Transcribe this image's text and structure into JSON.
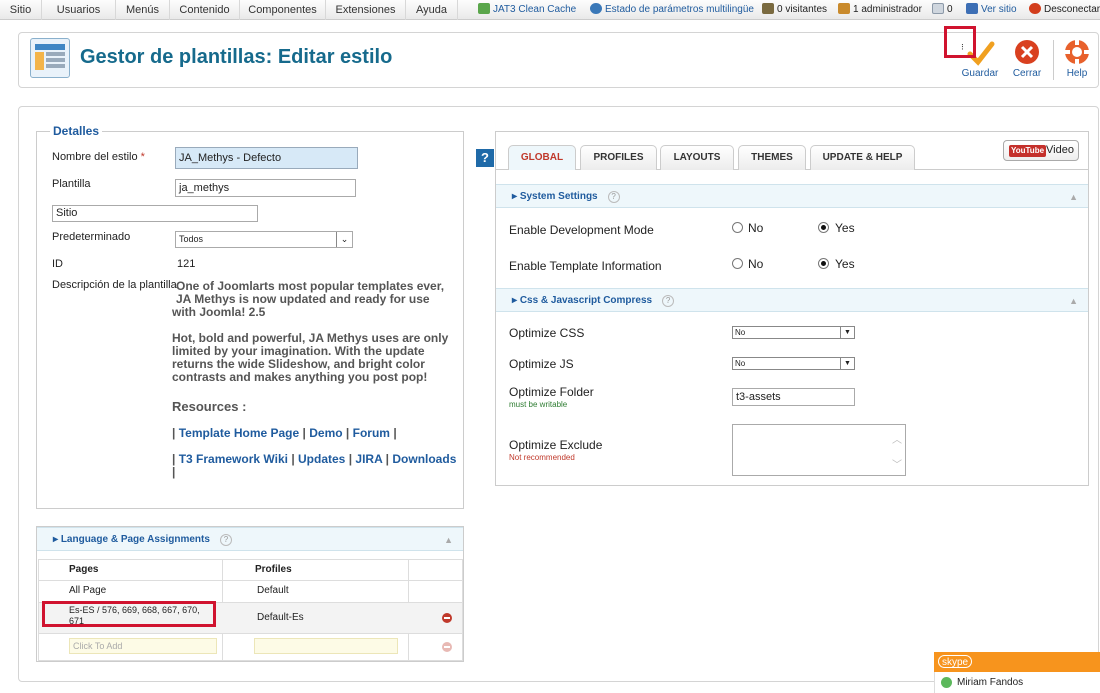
{
  "top_menu": [
    "Sitio",
    "Usuarios",
    "Menús",
    "Contenido",
    "Componentes",
    "Extensiones",
    "Ayuda"
  ],
  "status": {
    "jat3": "JAT3 Clean Cache",
    "multilang": "Estado de parámetros multilingüe",
    "visitors": "0 visitantes",
    "admins": "1 administrador",
    "messages": "0",
    "view_site": "Ver sitio",
    "logout": "Desconectar"
  },
  "header": {
    "title": "Gestor de plantillas: Editar estilo",
    "save": "Guardar",
    "close": "Cerrar",
    "help": "Help"
  },
  "details": {
    "legend": "Detalles",
    "style_name_label": "Nombre del estilo",
    "required_mark": "*",
    "style_name_value": "JA_Methys - Defecto",
    "template_label": "Plantilla",
    "template_value": "ja_methys",
    "site_value": "Sitio",
    "default_label": "Predeterminado",
    "default_value": "Todos",
    "id_label": "ID",
    "id_value": "121",
    "desc_label": "Descripción de la plantilla",
    "desc_p1_l1": "One of Joomlarts most popular templates ever,",
    "desc_p1_l2": "JA Methys is now updated and ready for use",
    "desc_p1_l3": "with Joomla! 2.5",
    "desc_p2_l1": "Hot, bold and powerful, JA Methys uses are only",
    "desc_p2_l2": "limited by your imagination. With the update",
    "desc_p2_l3": "returns the wide Slideshow, and bright color",
    "desc_p2_l4": "contrasts and makes anything you post pop!",
    "resources": "Resources :",
    "links1": [
      "Template Home Page",
      "Demo",
      "Forum"
    ],
    "links2": [
      "T3 Framework Wiki",
      "Updates",
      "JIRA",
      "Downloads"
    ],
    "sep": "|"
  },
  "tabs": [
    "GLOBAL",
    "PROFILES",
    "LAYOUTS",
    "THEMES",
    "UPDATE & HELP"
  ],
  "video_button": "Video",
  "video_brand": "YouTube",
  "system_settings": {
    "title": "System Settings",
    "rows": [
      {
        "label": "Enable Development Mode",
        "no": "No",
        "yes": "Yes",
        "selected": "Yes"
      },
      {
        "label": "Enable Template Information",
        "no": "No",
        "yes": "Yes",
        "selected": "Yes"
      }
    ]
  },
  "compress": {
    "title": "Css & Javascript Compress",
    "optimize_css_label": "Optimize CSS",
    "optimize_css_value": "No",
    "optimize_js_label": "Optimize JS",
    "optimize_js_value": "No",
    "optimize_folder_label": "Optimize Folder",
    "optimize_folder_note": "must be writable",
    "optimize_folder_value": "t3-assets",
    "optimize_exclude_label": "Optimize Exclude",
    "optimize_exclude_note": "Not recommended"
  },
  "assignments": {
    "title": "Language & Page Assignments",
    "col_pages": "Pages",
    "col_profiles": "Profiles",
    "rows": [
      {
        "page": "All Page",
        "profile": "Default"
      },
      {
        "page": "Es-ES / 576, 669, 668, 667, 670,",
        "page2": "671",
        "profile": "Default-Es"
      }
    ],
    "add_placeholder": "Click To Add"
  },
  "skype": {
    "brand": "skype",
    "contact": "Miriam Fandos"
  },
  "colors": {
    "title_blue": "#166a8c",
    "link_blue": "#1f5b9e",
    "highlight_red": "#d0132f",
    "skype_orange": "#f7941d"
  }
}
